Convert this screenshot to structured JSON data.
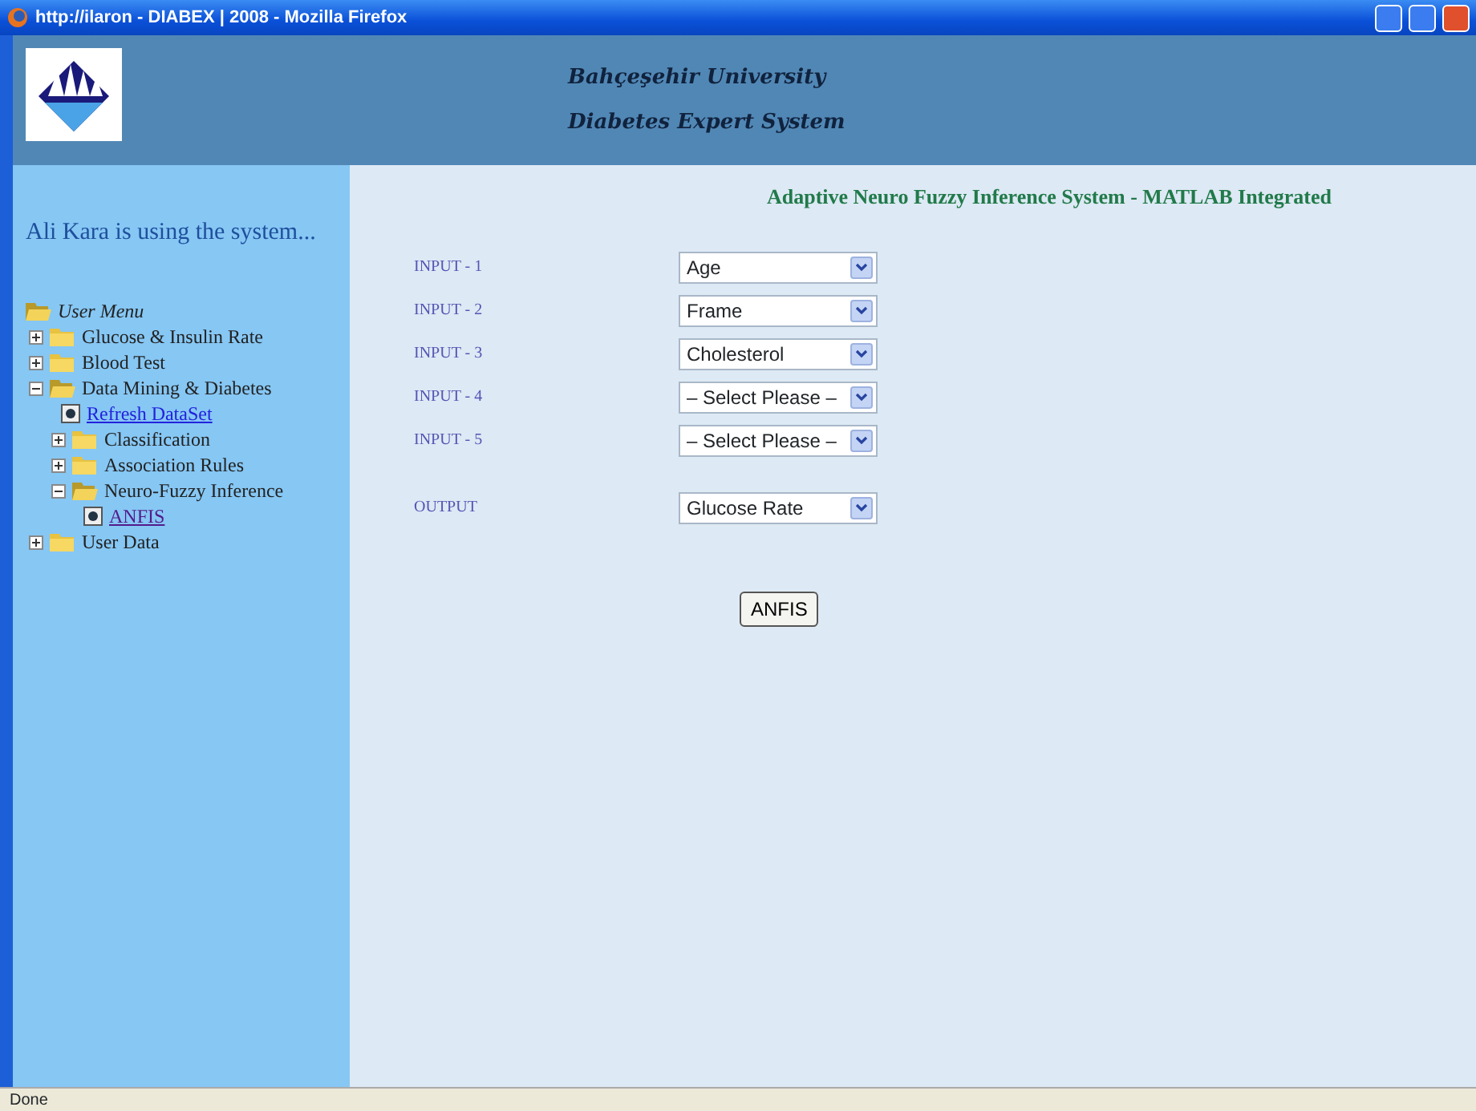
{
  "window": {
    "title": "http://ilaron - DIABEX | 2008 - Mozilla Firefox"
  },
  "header": {
    "lines": [
      "Bahçeşehir University",
      "Diabetes Expert System"
    ]
  },
  "sidebar": {
    "user_text": "Ali Kara is using the system...",
    "menu": {
      "label": "User Menu",
      "expanded": true,
      "children": [
        {
          "kind": "folder",
          "label": "Glucose & Insulin Rate",
          "expanded": false
        },
        {
          "kind": "folder",
          "label": "Blood Test",
          "expanded": false
        },
        {
          "kind": "folder",
          "label": "Data Mining & Diabetes",
          "expanded": true,
          "children": [
            {
              "kind": "page",
              "label": "Refresh DataSet",
              "visited": false
            },
            {
              "kind": "folder",
              "label": "Classification",
              "expanded": false
            },
            {
              "kind": "folder",
              "label": "Association Rules",
              "expanded": false
            },
            {
              "kind": "folder",
              "label": "Neuro-Fuzzy Inference",
              "expanded": true,
              "children": [
                {
                  "kind": "page",
                  "label": "ANFIS",
                  "visited": true
                }
              ]
            }
          ]
        },
        {
          "kind": "folder",
          "label": "User Data",
          "expanded": false
        }
      ]
    }
  },
  "main": {
    "title": "Adaptive Neuro Fuzzy Inference System - MATLAB Integrated",
    "fields": [
      {
        "label": "INPUT - 1",
        "value": "Age"
      },
      {
        "label": "INPUT - 2",
        "value": "Frame"
      },
      {
        "label": "INPUT - 3",
        "value": "Cholesterol"
      },
      {
        "label": "INPUT - 4",
        "value": "– Select Please –"
      },
      {
        "label": "INPUT - 5",
        "value": "– Select Please –"
      },
      {
        "label": "OUTPUT",
        "value": "Glucose Rate"
      }
    ],
    "button": "ANFIS"
  },
  "status_bar": "Done"
}
